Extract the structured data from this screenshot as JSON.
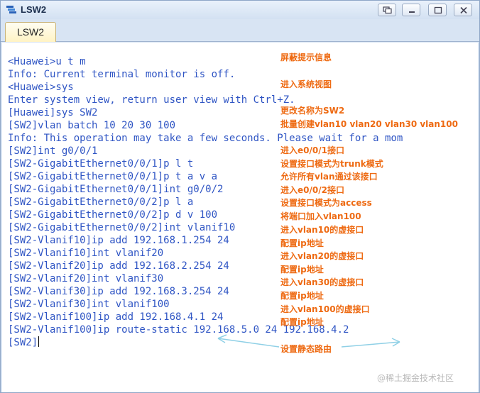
{
  "window": {
    "title": "LSW2",
    "icon": "switch-terminal-icon",
    "buttons": [
      "restore-icon",
      "minimize-icon",
      "close-icon"
    ]
  },
  "tabs": [
    {
      "label": "LSW2",
      "active": true
    }
  ],
  "terminal": {
    "lines": [
      "<Huawei>u t m",
      "Info: Current terminal monitor is off.",
      "<Huawei>sys",
      "Enter system view, return user view with Ctrl+Z.",
      "[Huawei]sys SW2",
      "[SW2]vlan batch 10 20 30 100",
      "Info: This operation may take a few seconds. Please wait for a mom",
      "[SW2]int g0/0/1",
      "[SW2-GigabitEthernet0/0/1]p l t",
      "[SW2-GigabitEthernet0/0/1]p t a v a",
      "[SW2-GigabitEthernet0/0/1]int g0/0/2",
      "[SW2-GigabitEthernet0/0/2]p l a",
      "[SW2-GigabitEthernet0/0/2]p d v 100",
      "[SW2-GigabitEthernet0/0/2]int vlanif10",
      "[SW2-Vlanif10]ip add 192.168.1.254 24",
      "[SW2-Vlanif10]int vlanif20",
      "[SW2-Vlanif20]ip add 192.168.2.254 24",
      "[SW2-Vlanif20]int vlanif30",
      "[SW2-Vlanif30]ip add 192.168.3.254 24",
      "[SW2-Vlanif30]int vlanif100",
      "[SW2-Vlanif100]ip add 192.168.4.1 24",
      "[SW2-Vlanif100]ip route-static 192.168.5.0 24 192.168.4.2",
      "[SW2]"
    ],
    "text_color": "#2f55c4"
  },
  "annotations": [
    "屏蔽提示信息",
    "进入系统视图",
    "更改名称为SW2",
    "批量创建vlan10 vlan20 vlan30 vlan100",
    "进入e0/0/1接口",
    "设置接口模式为trunk模式",
    "允许所有vlan通过该接口",
    "进入e0/0/2接口",
    "设置接口模式为access",
    "将端口加入vlan100",
    "进入vlan10的虚接口",
    "配置ip地址",
    "进入vlan20的虚接口",
    "配置ip地址",
    "进入vlan30的虚接口",
    "配置ip地址",
    "进入vlan100的虚接口",
    "配置ip地址",
    "设置静态路由"
  ],
  "annotation_color": "#ee6a12",
  "watermark": "@稀土掘金技术社区"
}
